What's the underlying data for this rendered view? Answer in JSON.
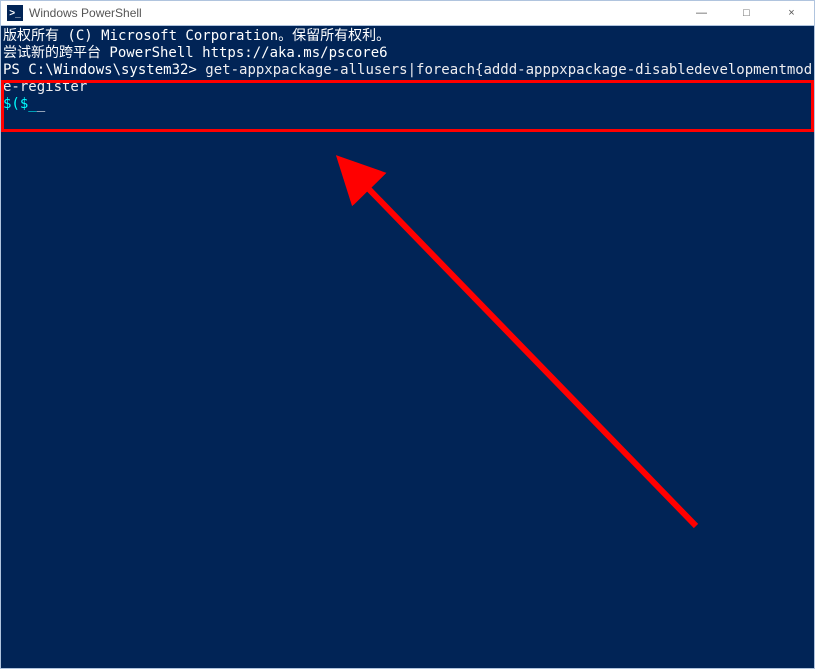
{
  "titlebar": {
    "icon_glyph": ">_",
    "title": "Windows PowerShell",
    "minimize": "—",
    "maximize": "□",
    "close": "×"
  },
  "terminal": {
    "line1": "版权所有 (C) Microsoft Corporation。保留所有权利。",
    "line2": "",
    "line3": "尝试新的跨平台 PowerShell https://aka.ms/pscore6",
    "line4": "",
    "prompt": "PS C:\\Windows\\system32> ",
    "command": "get-appxpackage-allusers|foreach{addd-apppxpackage-disabledevelopmentmode-register",
    "command_wrap": "$($_"
  },
  "annotation": {
    "highlight_color": "#ff0000",
    "arrow_color": "#ff0000"
  }
}
